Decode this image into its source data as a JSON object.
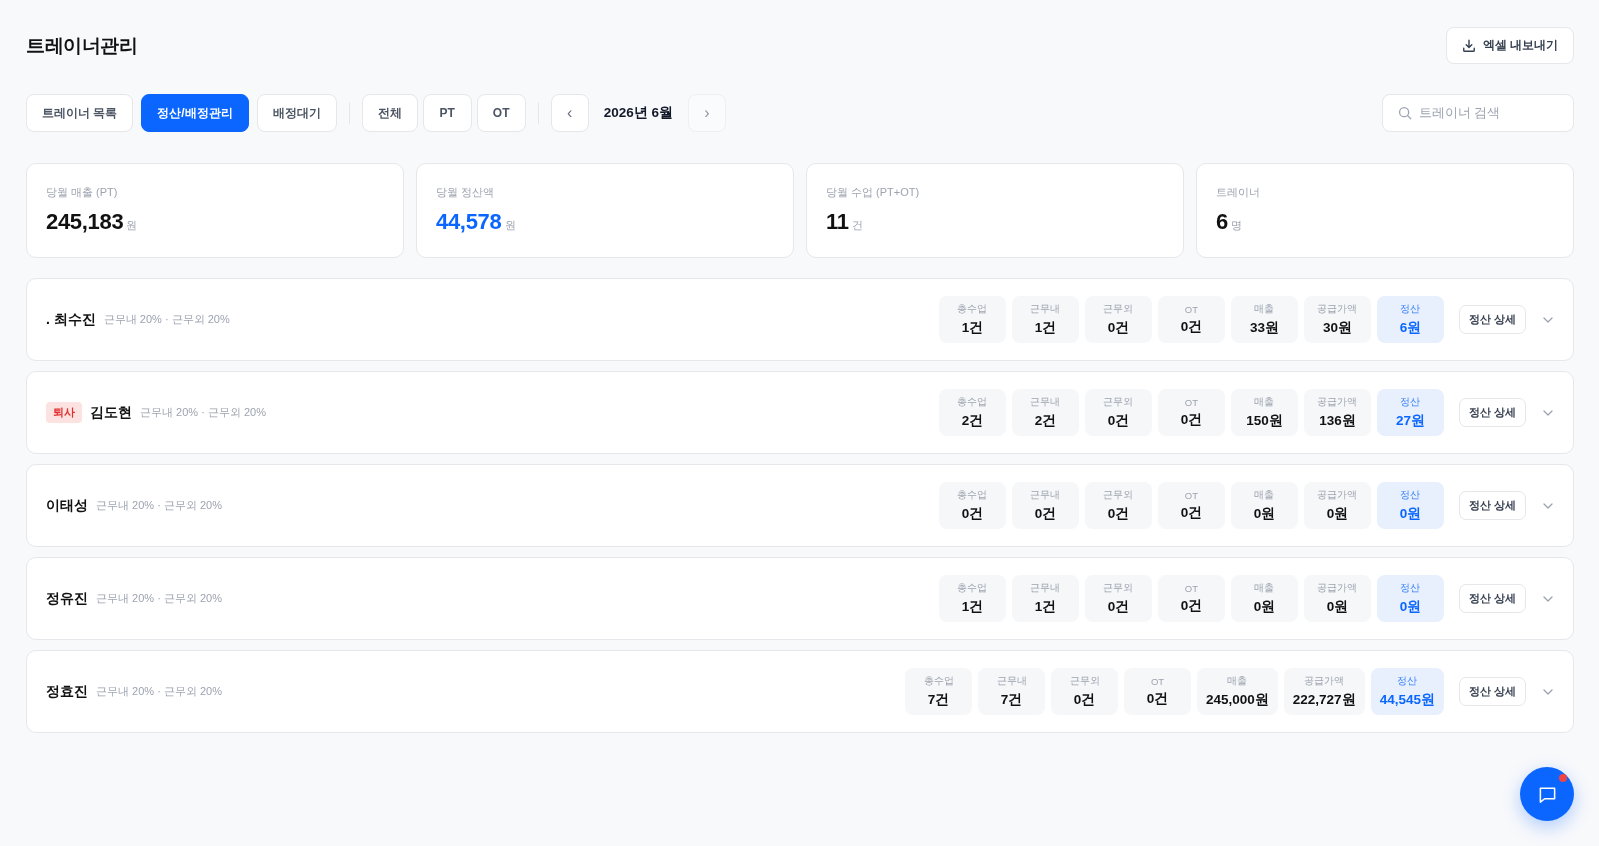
{
  "page": {
    "title": "트레이너관리"
  },
  "export_button": {
    "label": "엑셀 내보내기"
  },
  "view_tabs": [
    {
      "label": "트레이너 목록",
      "selected": false
    },
    {
      "label": "정산/배정관리",
      "selected": true
    },
    {
      "label": "배정대기",
      "selected": false
    }
  ],
  "type_filters": [
    {
      "label": "전체",
      "selected": false
    },
    {
      "label": "PT",
      "selected": false
    },
    {
      "label": "OT",
      "selected": false
    }
  ],
  "month_nav": {
    "label": "2026년 6월",
    "prev": {
      "label": "‹",
      "disabled": false
    },
    "next": {
      "label": "›",
      "disabled": true
    }
  },
  "search": {
    "placeholder": "트레이너 검색"
  },
  "summary_cards": [
    {
      "label": "당월 매출 (PT)",
      "value": "245,183",
      "unit": "원",
      "highlighted": false
    },
    {
      "label": "당월 정산액",
      "value": "44,578",
      "unit": "원",
      "highlighted": true
    },
    {
      "label": "당월 수업 (PT+OT)",
      "value": "11",
      "unit": "건",
      "highlighted": false
    },
    {
      "label": "트레이너",
      "value": "6",
      "unit": "명",
      "highlighted": false
    }
  ],
  "trainers": [
    {
      "name": ". 최수진",
      "rates": "근무내 20% · 근무외 20%",
      "metrics": [
        {
          "label": "총수업",
          "value": "1건",
          "highlighted": false
        },
        {
          "label": "근무내",
          "value": "1건",
          "highlighted": false
        },
        {
          "label": "근무외",
          "value": "0건",
          "highlighted": false
        },
        {
          "label": "OT",
          "value": "0건",
          "highlighted": false
        },
        {
          "label": "매출",
          "value": "33원",
          "highlighted": false
        },
        {
          "label": "공급가액",
          "value": "30원",
          "highlighted": false
        },
        {
          "label": "정산",
          "value": "6원",
          "highlighted": true
        }
      ],
      "detail_button": "정산 상세",
      "expanded": false
    },
    {
      "badge": "퇴사",
      "name": "김도현",
      "rates": "근무내 20% · 근무외 20%",
      "metrics": [
        {
          "label": "총수업",
          "value": "2건",
          "highlighted": false
        },
        {
          "label": "근무내",
          "value": "2건",
          "highlighted": false
        },
        {
          "label": "근무외",
          "value": "0건",
          "highlighted": false
        },
        {
          "label": "OT",
          "value": "0건",
          "highlighted": false
        },
        {
          "label": "매출",
          "value": "150원",
          "highlighted": false
        },
        {
          "label": "공급가액",
          "value": "136원",
          "highlighted": false
        },
        {
          "label": "정산",
          "value": "27원",
          "highlighted": true
        }
      ],
      "detail_button": "정산 상세",
      "expanded": false
    },
    {
      "name": "이태성",
      "rates": "근무내 20% · 근무외 20%",
      "metrics": [
        {
          "label": "총수업",
          "value": "0건",
          "highlighted": false
        },
        {
          "label": "근무내",
          "value": "0건",
          "highlighted": false
        },
        {
          "label": "근무외",
          "value": "0건",
          "highlighted": false
        },
        {
          "label": "OT",
          "value": "0건",
          "highlighted": false
        },
        {
          "label": "매출",
          "value": "0원",
          "highlighted": false
        },
        {
          "label": "공급가액",
          "value": "0원",
          "highlighted": false
        },
        {
          "label": "정산",
          "value": "0원",
          "highlighted": true
        }
      ],
      "detail_button": "정산 상세",
      "expanded": false
    },
    {
      "name": "정유진",
      "rates": "근무내 20% · 근무외 20%",
      "metrics": [
        {
          "label": "총수업",
          "value": "1건",
          "highlighted": false
        },
        {
          "label": "근무내",
          "value": "1건",
          "highlighted": false
        },
        {
          "label": "근무외",
          "value": "0건",
          "highlighted": false
        },
        {
          "label": "OT",
          "value": "0건",
          "highlighted": false
        },
        {
          "label": "매출",
          "value": "0원",
          "highlighted": false
        },
        {
          "label": "공급가액",
          "value": "0원",
          "highlighted": false
        },
        {
          "label": "정산",
          "value": "0원",
          "highlighted": true
        }
      ],
      "detail_button": "정산 상세",
      "expanded": false
    },
    {
      "name": "정효진",
      "rates": "근무내 20% · 근무외 20%",
      "metrics": [
        {
          "label": "총수업",
          "value": "7건",
          "highlighted": false
        },
        {
          "label": "근무내",
          "value": "7건",
          "highlighted": false
        },
        {
          "label": "근무외",
          "value": "0건",
          "highlighted": false
        },
        {
          "label": "OT",
          "value": "0건",
          "highlighted": false
        },
        {
          "label": "매출",
          "value": "245,000원",
          "highlighted": false
        },
        {
          "label": "공급가액",
          "value": "222,727원",
          "highlighted": false
        },
        {
          "label": "정산",
          "value": "44,545원",
          "highlighted": true
        }
      ],
      "detail_button": "정산 상세",
      "expanded": false
    }
  ],
  "chat_button": {
    "unread": true
  }
}
